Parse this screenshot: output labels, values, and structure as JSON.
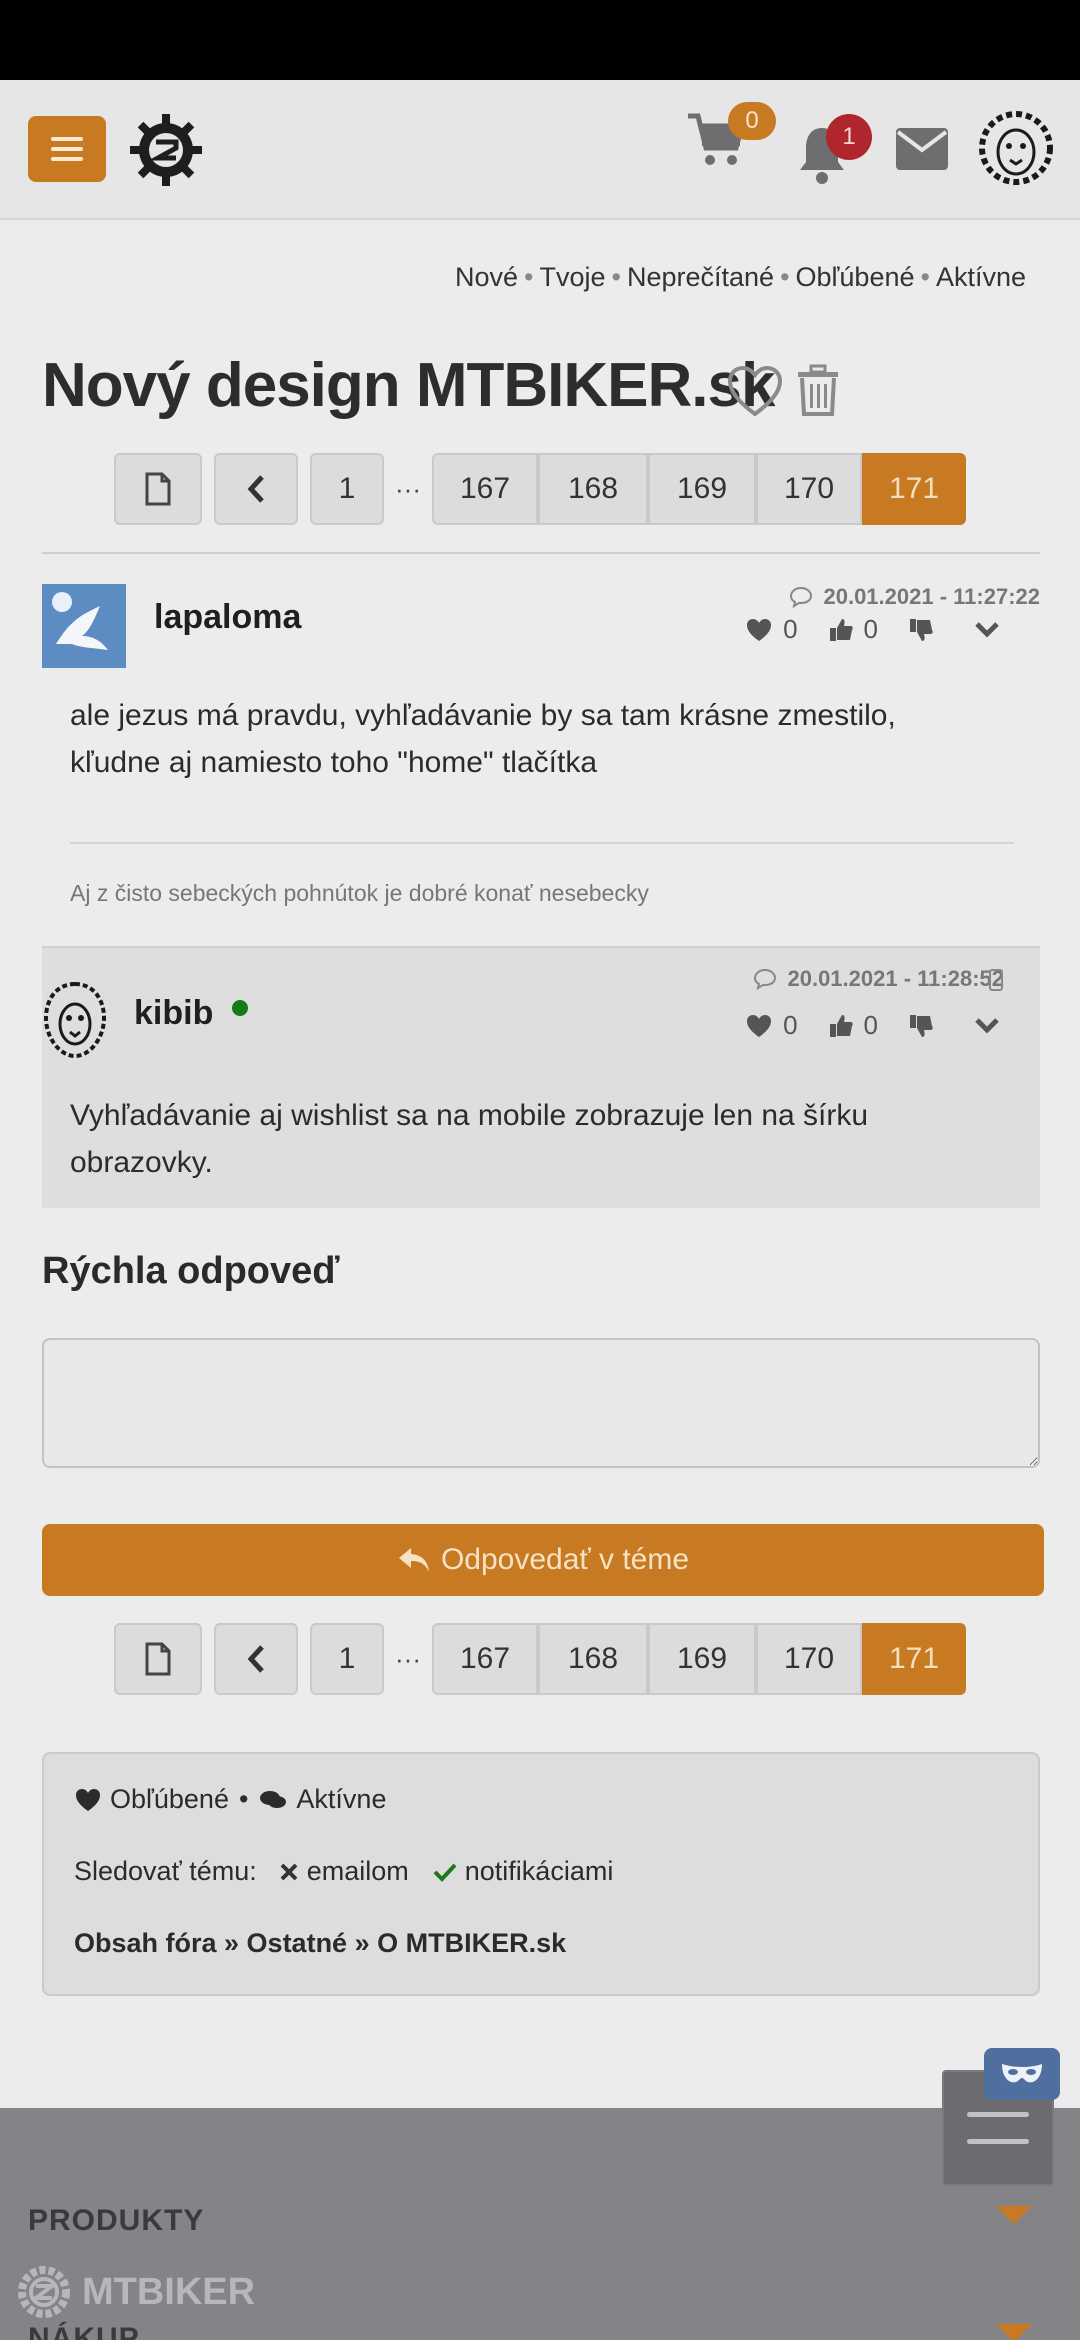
{
  "header": {
    "cart_count": "0",
    "notification_count": "1",
    "icons": [
      "menu-icon",
      "logo-gear-icon",
      "cart-icon",
      "bell-icon",
      "mail-icon",
      "lion-avatar"
    ]
  },
  "quicklinks": [
    "Nové",
    "Tvoje",
    "Neprečítané",
    "Obľúbené",
    "Aktívne"
  ],
  "thread": {
    "title": "Nový design MTBIKER.sk"
  },
  "pagination": {
    "first": "1",
    "dots": "···",
    "pages": [
      "167",
      "168",
      "169",
      "170",
      "171"
    ],
    "active": "171"
  },
  "posts": [
    {
      "author": "lapaloma",
      "date": "20.01.2021 - 11:27:22",
      "likes": "0",
      "thumbs": "0",
      "text_line1": "ale jezus má pravdu, vyhľadávanie by sa tam krásne zmestilo,",
      "text_line2": "kľudne aj namiesto toho \"home\" tlačítka",
      "signature": "Aj z čisto sebeckých pohnútok je dobré konať nesebecky"
    },
    {
      "author": "kibib",
      "date": "20.01.2021 - 11:28:52",
      "likes": "0",
      "thumbs": "0",
      "text_line1": "Vyhľadávanie aj wishlist sa na mobile zobrazuje len na šírku",
      "text_line2": "obrazovky."
    }
  ],
  "quick_reply": {
    "title": "Rýchla odpoveď",
    "button_label": "Odpovedať v téme"
  },
  "info": {
    "favorites": "Obľúbené",
    "active": "Aktívne",
    "follow_label": "Sledovať tému:",
    "email": "emailom",
    "notifications": "notifikáciami",
    "breadcrumb": "Obsah fóra » Ostatné » O MTBIKER.sk"
  },
  "footer": {
    "cat1": "PRODUKTY",
    "cat2": "NÁKUP",
    "logo_text": "MTBIKER"
  },
  "colors": {
    "accent": "#c77a22",
    "badge_red": "#b0262d",
    "online": "#1a7a1a"
  }
}
